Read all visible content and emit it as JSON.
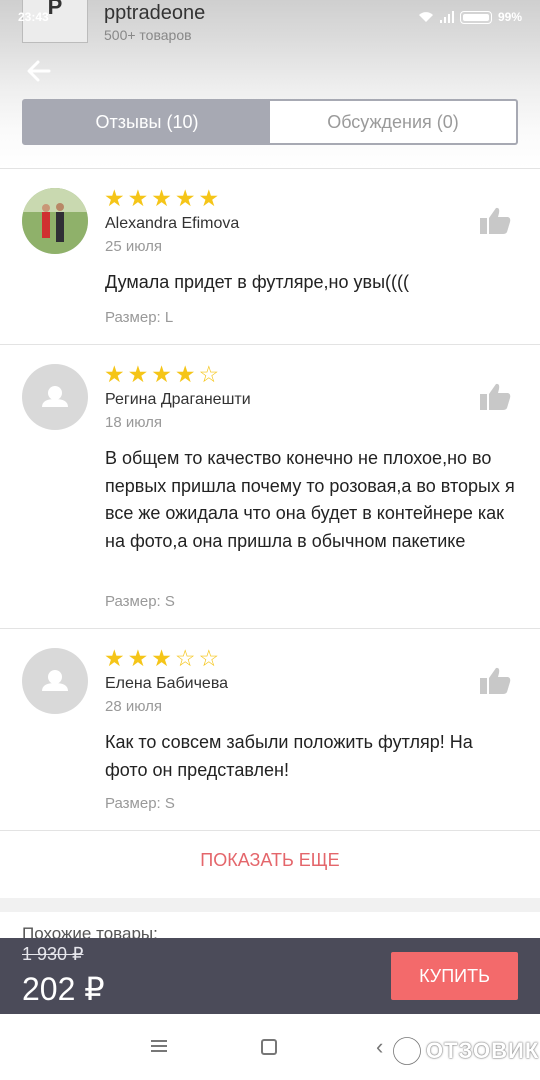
{
  "status": {
    "time": "23:43",
    "battery": "99%"
  },
  "store": {
    "logo_letter": "P",
    "name": "pptradeone",
    "count": "500+ товаров"
  },
  "tabs": [
    {
      "label": "Отзывы (10)",
      "active": true
    },
    {
      "label": "Обсуждения (0)",
      "active": false
    }
  ],
  "reviews": [
    {
      "rating": 5,
      "name": "Alexandra Efimova",
      "date": "25 июля",
      "text": "Думала придет в футляре,но увы((((",
      "size": "Размер: L"
    },
    {
      "rating": 4,
      "name": "Регина Драганешти",
      "date": "18 июля",
      "text": "В общем то качество конечно не плохое,но во первых пришла почему то розовая,а во вторых я все же ожидала что она будет в контейнере как на фото,а она пришла в обычном пакетике",
      "size": "Размер: S"
    },
    {
      "rating": 3,
      "name": "Елена Бабичева",
      "date": "28 июля",
      "text": "Как то совсем забыли положить футляр! На фото он представлен!",
      "size": "Размер: S"
    }
  ],
  "show_more": "ПОКАЗАТЬ ЕЩЕ",
  "similar_label": "Похожие товары:",
  "buy": {
    "old_price": "1 930 ₽",
    "price": "202 ₽",
    "button": "КУПИТЬ"
  },
  "watermark": "ОТЗОВИК",
  "colors": {
    "accent": "#f36a6b",
    "tab_active": "#a7a9b3",
    "buy_bar": "#4b4b59",
    "star": "#f5c518"
  }
}
